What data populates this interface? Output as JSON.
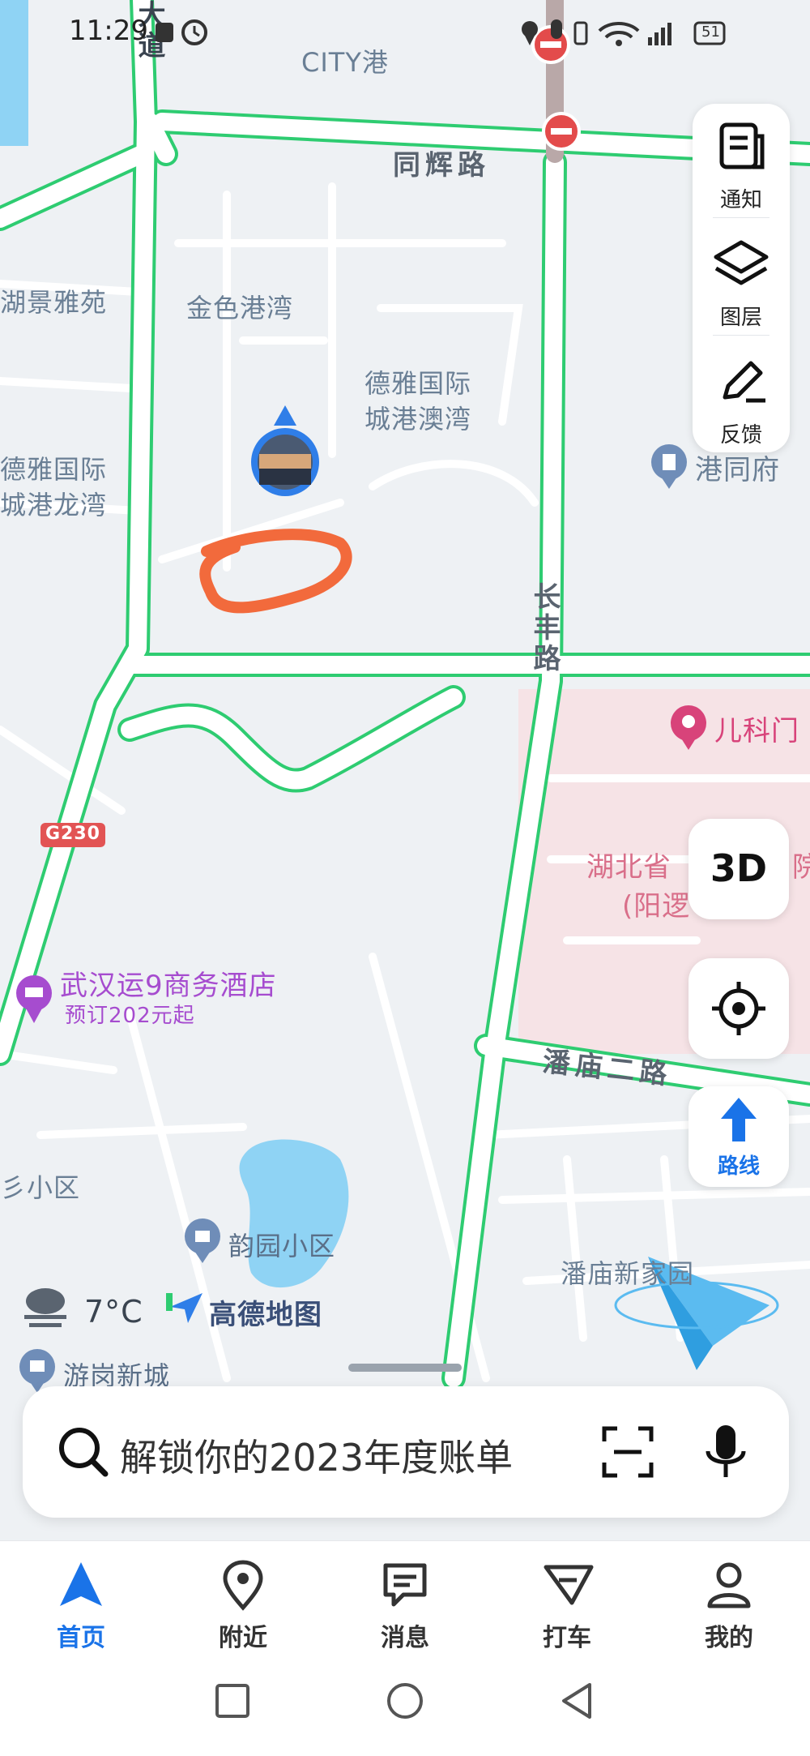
{
  "status_bar": {
    "time": "11:29",
    "battery": "51"
  },
  "map": {
    "labels": {
      "city_port": "CITY港",
      "tonghui_road": "同辉路",
      "dadao": "大道",
      "hujing": "湖景雅苑",
      "jinse": "金色港湾",
      "deya_aomen_1": "德雅国际",
      "deya_aomen_2": "城港澳湾",
      "deya_long_1": "德雅国际",
      "deya_long_2": "城港龙湾",
      "ganghongfu": "港同府",
      "changfeng_road": "长丰路",
      "pediatrics": "儿科门",
      "hospital_1": "湖北省",
      "hospital_1b": "院",
      "hospital_2": "(阳逻",
      "g230": "G230",
      "hotel_name": "武汉运9商务酒店",
      "hotel_price": "预订202元起",
      "panmiao_road": "潘庙二路",
      "xiaoqu": "彡小区",
      "yunyuan": "韵园小区",
      "weather_temp": "7°C",
      "brand": "高德地图",
      "yougang": "游岗新城",
      "panmiao_garden": "潘庙新家园"
    }
  },
  "tool_panel": {
    "notify": "通知",
    "layers": "图层",
    "feedback": "反馈"
  },
  "buttons": {
    "three_d": "3D",
    "route": "路线"
  },
  "search": {
    "placeholder": "解锁你的2023年度账单"
  },
  "bottom_nav": [
    {
      "label": "首页"
    },
    {
      "label": "附近"
    },
    {
      "label": "消息"
    },
    {
      "label": "打车"
    },
    {
      "label": "我的"
    }
  ],
  "colors": {
    "road_edge": "#2ecc71",
    "accent": "#1a73e8",
    "hotel_purple": "#a64ccf",
    "pin_pink": "#d8437a",
    "scribble": "#f26a3c",
    "water": "#8fd3f4"
  }
}
